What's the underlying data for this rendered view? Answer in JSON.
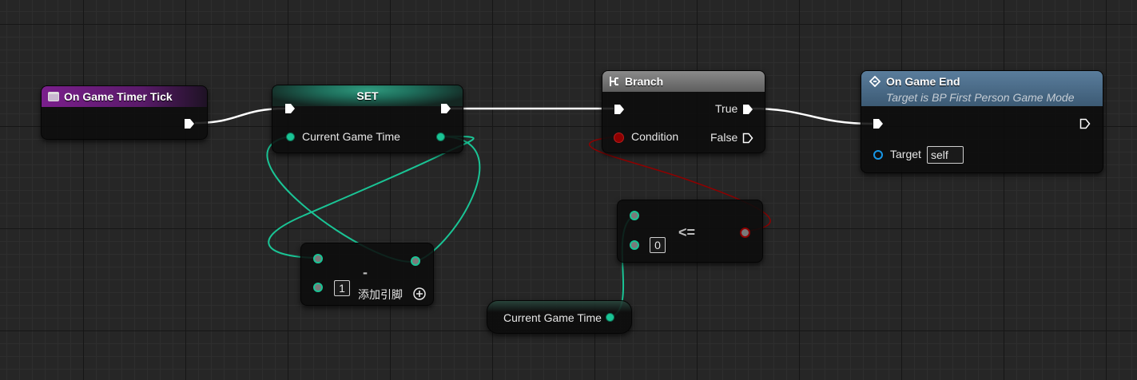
{
  "nodes": {
    "timer_tick": {
      "title": "On Game Timer Tick"
    },
    "set": {
      "title": "SET",
      "pin_label": "Current Game Time"
    },
    "branch": {
      "title": "Branch",
      "condition_label": "Condition",
      "true_label": "True",
      "false_label": "False"
    },
    "game_end": {
      "title": "On Game End",
      "subtitle": "Target is BP First Person Game Mode",
      "target_label": "Target",
      "target_value": "self"
    },
    "subtract": {
      "operator": "-",
      "b_value": "1",
      "add_pin_label": "添加引脚"
    },
    "compare": {
      "operator": "<=",
      "b_value": "0"
    },
    "getter": {
      "label": "Current Game Time"
    }
  },
  "colors": {
    "exec_wire": "#ffffff",
    "float_wire": "#1ac495",
    "bool_wire": "#8e0000",
    "event_header": "#7a1f8c",
    "set_header": "#1e6e5b",
    "branch_header": "#6e6e6e",
    "function_header": "#4a6a86",
    "object_pin": "#1797e7"
  },
  "icons": {
    "event": "event-node-icon",
    "branch": "branch-icon",
    "function": "function-icon",
    "add_pin": "plus-circle-icon"
  }
}
